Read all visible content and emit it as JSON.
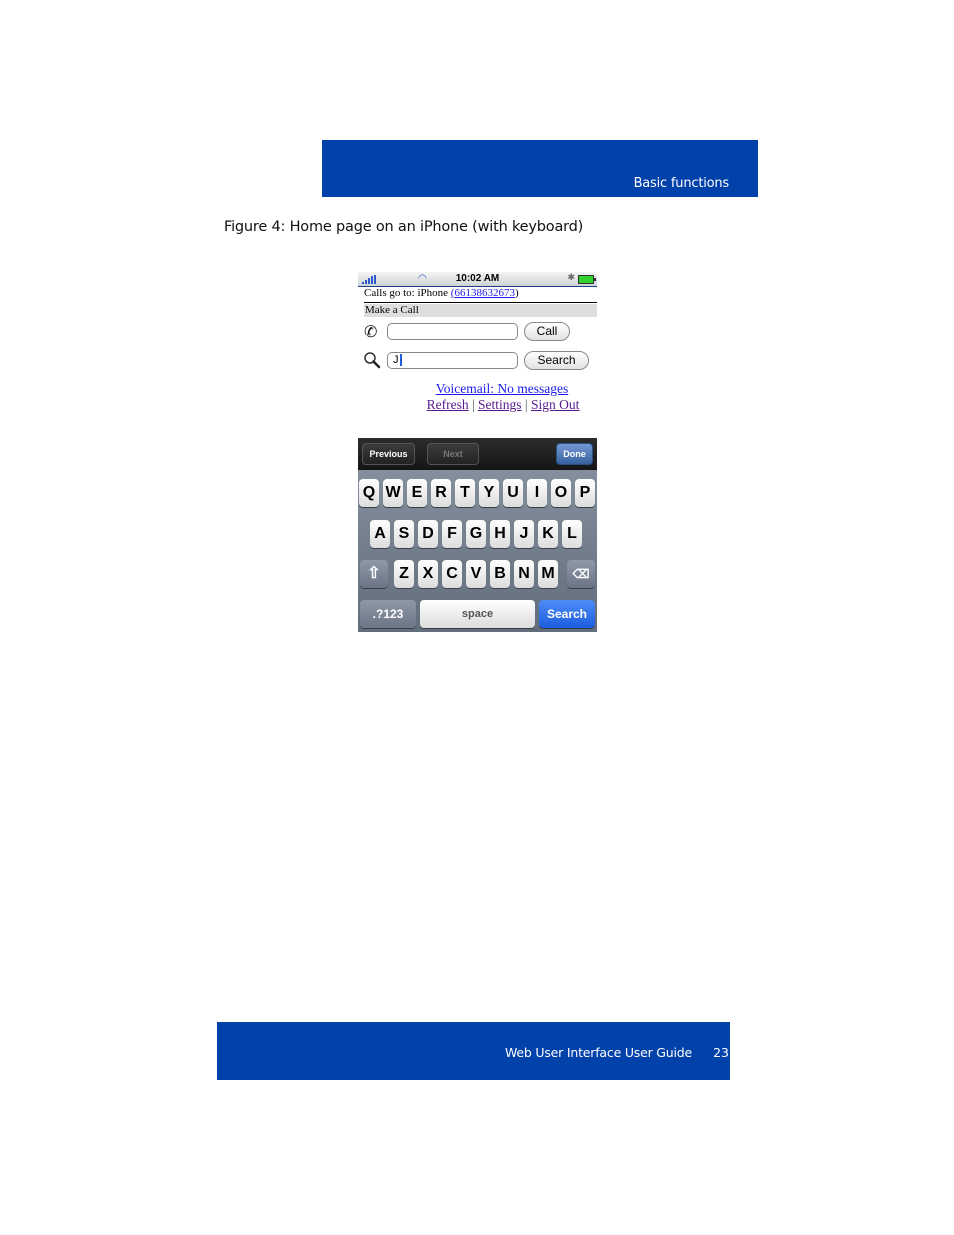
{
  "header": {
    "section_title": "Basic functions"
  },
  "figure": {
    "caption": "Figure 4: Home page on an iPhone (with keyboard)"
  },
  "phone": {
    "status_bar": {
      "time": "10:02 AM",
      "signal_icon": "signal-bars-icon",
      "wifi_icon": "wifi-icon",
      "bluetooth_icon": "bluetooth-icon",
      "battery_icon": "battery-icon"
    },
    "calls_go_to_label": "Calls go to: iPhone ",
    "calls_go_to_number": "(66138632673)",
    "calls_go_to_open": "(",
    "calls_go_to_digits": "66138632673",
    "calls_go_to_close": ")",
    "make_call_heading": "Make a Call",
    "call_input": {
      "value": "",
      "placeholder": ""
    },
    "call_button": "Call",
    "search_input": {
      "value": "J"
    },
    "search_button": "Search",
    "voicemail_link": "Voicemail: No messages",
    "nav_links": [
      "Refresh",
      "Settings",
      "Sign Out"
    ],
    "separator": "|",
    "keyboard": {
      "toolbar": {
        "previous": "Previous",
        "next": "Next",
        "done": "Done"
      },
      "row1": [
        "Q",
        "W",
        "E",
        "R",
        "T",
        "Y",
        "U",
        "I",
        "O",
        "P"
      ],
      "row2": [
        "A",
        "S",
        "D",
        "F",
        "G",
        "H",
        "J",
        "K",
        "L"
      ],
      "row3": [
        "Z",
        "X",
        "C",
        "V",
        "B",
        "N",
        "M"
      ],
      "shift_icon": "shift-arrow-icon",
      "backspace_icon": "backspace-icon",
      "numbers_key": ".?123",
      "space_key": "space",
      "action_key": "Search"
    }
  },
  "footer": {
    "guide_title": "Web User Interface User Guide",
    "page_number": "23"
  }
}
